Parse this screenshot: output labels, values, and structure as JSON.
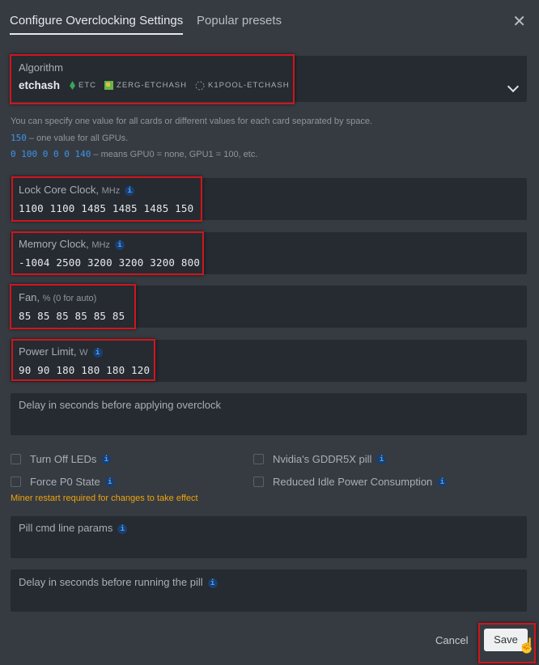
{
  "header": {
    "tabs": [
      {
        "label": "Configure Overclocking Settings",
        "active": true
      },
      {
        "label": "Popular presets",
        "active": false
      }
    ],
    "close_icon": "close-icon"
  },
  "algorithm": {
    "label": "Algorithm",
    "value": "etchash",
    "coins": [
      {
        "icon": "etc-icon",
        "name": "ETC"
      },
      {
        "icon": "zerg-icon",
        "name": "ZERG-ETCHASH"
      },
      {
        "icon": "k1pool-icon",
        "name": "K1POOL-ETCHASH"
      }
    ]
  },
  "help": {
    "line1": "You can specify one value for all cards or different values for each card separated by space.",
    "line2_code": "150",
    "line2_text": " – one value for all GPUs.",
    "line3_code": "0 100 0 0 0 140",
    "line3_text": " – means GPU0 = none, GPU1 = 100, etc."
  },
  "fields": {
    "core_clock": {
      "label": "Lock Core Clock,",
      "unit": "MHz",
      "value": "1100 1100 1485 1485 1485 150"
    },
    "memory_clock": {
      "label": "Memory Clock,",
      "unit": "MHz",
      "value": "-1004 2500 3200 3200 3200 800"
    },
    "fan": {
      "label": "Fan,",
      "unit": "% (0 for auto)",
      "value": "85 85 85 85 85 85"
    },
    "power_limit": {
      "label": "Power Limit,",
      "unit": "W",
      "value": "90 90 180 180 180 120"
    },
    "delay_overclock": {
      "label": "Delay in seconds before applying overclock",
      "value": ""
    },
    "pill_params": {
      "label": "Pill cmd line params",
      "value": ""
    },
    "pill_delay": {
      "label": "Delay in seconds before running the pill",
      "value": ""
    }
  },
  "checkboxes": [
    {
      "label": "Turn Off LEDs",
      "checked": false
    },
    {
      "label": "Nvidia's GDDR5X pill",
      "checked": false
    },
    {
      "label": "Force P0 State",
      "checked": false
    },
    {
      "label": "Reduced Idle Power Consumption",
      "checked": false
    }
  ],
  "warning": "Miner restart required for changes to take effect",
  "info_glyph": "i",
  "footer": {
    "cancel": "Cancel",
    "save": "Save"
  },
  "colors": {
    "highlight": "#d0161b",
    "link": "#3d93e8",
    "warning": "#f0a30a"
  }
}
